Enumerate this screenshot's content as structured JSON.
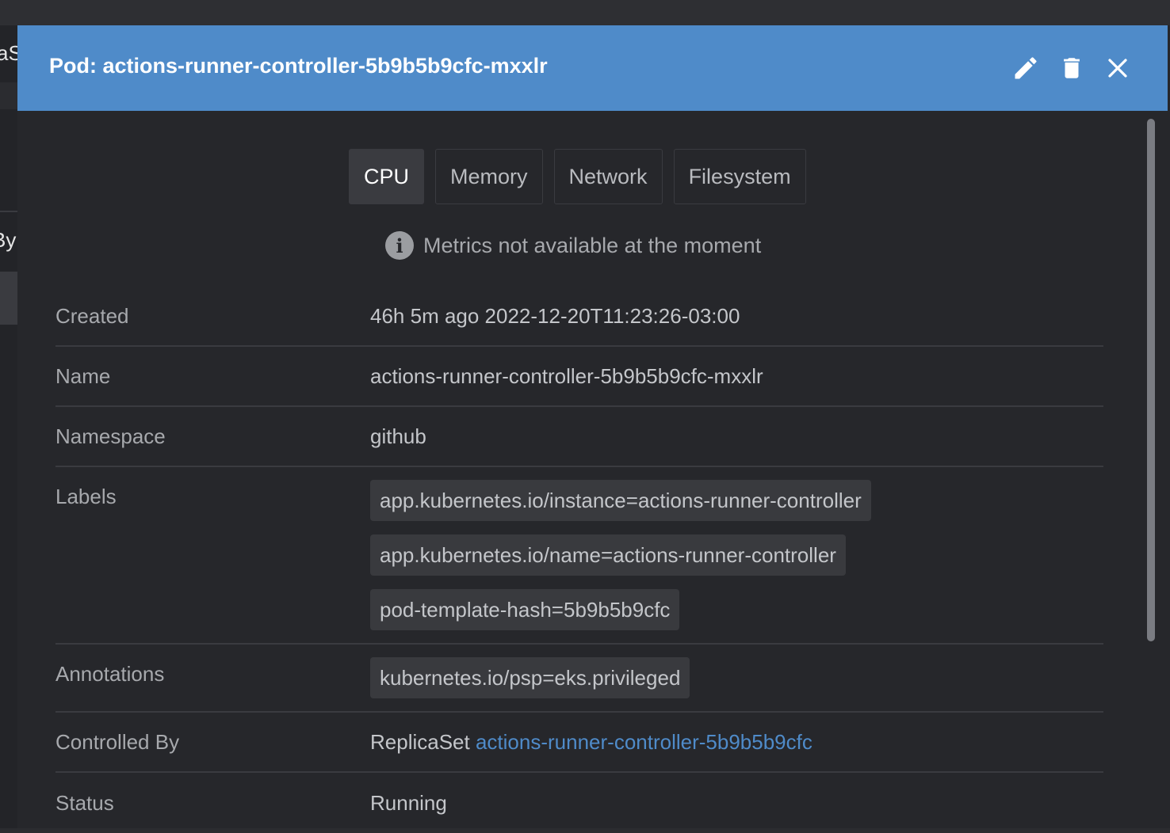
{
  "background": {
    "fragment_top": "aS",
    "fragment_by": "By"
  },
  "header": {
    "title": "Pod: actions-runner-controller-5b9b5b9cfc-mxxlr",
    "edit_icon": "pencil-icon",
    "delete_icon": "trash-icon",
    "close_icon": "close-icon"
  },
  "tabs": [
    {
      "label": "CPU",
      "active": true
    },
    {
      "label": "Memory",
      "active": false
    },
    {
      "label": "Network",
      "active": false
    },
    {
      "label": "Filesystem",
      "active": false
    }
  ],
  "notice": {
    "icon": "info-icon",
    "icon_glyph": "i",
    "text": "Metrics not available at the moment"
  },
  "details": {
    "created": {
      "key": "Created",
      "value": "46h 5m ago 2022-12-20T11:23:26-03:00"
    },
    "name": {
      "key": "Name",
      "value": "actions-runner-controller-5b9b5b9cfc-mxxlr"
    },
    "namespace": {
      "key": "Namespace",
      "value": "github"
    },
    "labels": {
      "key": "Labels",
      "values": [
        "app.kubernetes.io/instance=actions-runner-controller",
        "app.kubernetes.io/name=actions-runner-controller",
        "pod-template-hash=5b9b5b9cfc"
      ]
    },
    "annotations": {
      "key": "Annotations",
      "values": [
        "kubernetes.io/psp=eks.privileged"
      ]
    },
    "controlled_by": {
      "key": "Controlled By",
      "kind": "ReplicaSet",
      "link": "actions-runner-controller-5b9b5b9cfc"
    },
    "status": {
      "key": "Status",
      "value": "Running"
    }
  },
  "colors": {
    "header_bg": "#4f8bc9",
    "link": "#4f8bc9",
    "running": "#5aa74f",
    "panel_bg": "#26272b"
  }
}
